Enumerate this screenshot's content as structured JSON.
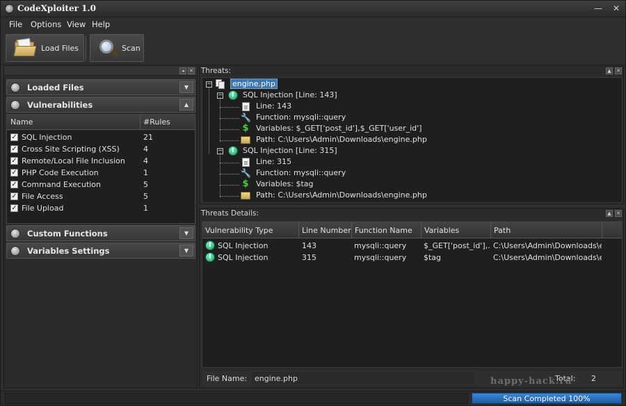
{
  "window": {
    "title": "CodeXploiter 1.0",
    "minimize": "—",
    "close": "✕"
  },
  "menu": [
    "File",
    "Options",
    "View",
    "Help"
  ],
  "toolbar": {
    "load_files": "Load Files",
    "scan": "Scan"
  },
  "sidebar": {
    "loaded_files": "Loaded Files",
    "vulnerabilities": "Vulnerabilities",
    "custom_functions": "Custom Functions",
    "variables_settings": "Variables Settings",
    "table": {
      "col_name": "Name",
      "col_rules": "#Rules",
      "rows": [
        {
          "name": "SQL Injection",
          "rules": "21",
          "checked": true
        },
        {
          "name": "Cross Site Scripting (XSS)",
          "rules": "4",
          "checked": true
        },
        {
          "name": "Remote/Local File Inclusion",
          "rules": "4",
          "checked": true
        },
        {
          "name": "PHP Code Execution",
          "rules": "1",
          "checked": true
        },
        {
          "name": "Command Execution",
          "rules": "5",
          "checked": true
        },
        {
          "name": "File Access",
          "rules": "5",
          "checked": true
        },
        {
          "name": "File Upload",
          "rules": "1",
          "checked": true
        }
      ]
    }
  },
  "threats": {
    "title": "Threats:",
    "file": "engine.php",
    "items": [
      {
        "label": "SQL Injection  [Line: 143]",
        "line": "Line: 143",
        "function": "Function: mysqli::query",
        "variables": "Variables: $_GET['post_id'],$_GET['user_id']",
        "path": "Path: C:\\Users\\Admin\\Downloads\\engine.php"
      },
      {
        "label": "SQL Injection  [Line: 315]",
        "line": "Line: 315",
        "function": "Function: mysqli::query",
        "variables": "Variables: $tag",
        "path": "Path: C:\\Users\\Admin\\Downloads\\engine.php"
      }
    ]
  },
  "details": {
    "title": "Threats Details:",
    "columns": [
      "Vulnerability Type",
      "Line Number",
      "Function Name",
      "Variables",
      "Path"
    ],
    "rows": [
      {
        "type": "SQL Injection",
        "line": "143",
        "function": "mysqli::query",
        "variables": "$_GET['post_id'],...",
        "path": "C:\\Users\\Admin\\Downloads\\e..."
      },
      {
        "type": "SQL Injection",
        "line": "315",
        "function": "mysqli::query",
        "variables": "$tag",
        "path": "C:\\Users\\Admin\\Downloads\\e..."
      }
    ],
    "footer": {
      "file_name_label": "File Name:",
      "file_name": "engine.php",
      "total_label": "Total:",
      "total": "2"
    }
  },
  "watermark": "happy-hack.ru",
  "status": {
    "progress_text": "Scan Completed  100%",
    "progress": 1.0
  }
}
